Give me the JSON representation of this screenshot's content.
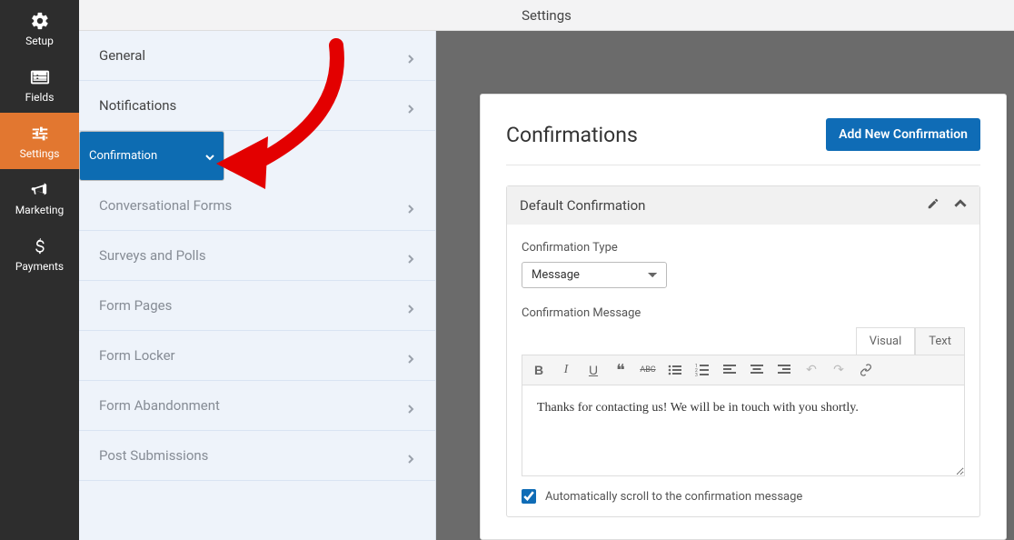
{
  "top": {
    "title": "Settings"
  },
  "nav": {
    "items": [
      {
        "label": "Setup",
        "icon": "gear"
      },
      {
        "label": "Fields",
        "icon": "list"
      },
      {
        "label": "Settings",
        "icon": "sliders",
        "active": true
      },
      {
        "label": "Marketing",
        "icon": "bullhorn"
      },
      {
        "label": "Payments",
        "icon": "dollar"
      }
    ]
  },
  "settings_menu": {
    "items": [
      {
        "label": "General",
        "style": "dark"
      },
      {
        "label": "Notifications",
        "style": "dark"
      },
      {
        "label": "Confirmation",
        "style": "selected"
      },
      {
        "label": "Conversational Forms",
        "style": "dim"
      },
      {
        "label": "Surveys and Polls",
        "style": "dim"
      },
      {
        "label": "Form Pages",
        "style": "dim"
      },
      {
        "label": "Form Locker",
        "style": "dim"
      },
      {
        "label": "Form Abandonment",
        "style": "dim"
      },
      {
        "label": "Post Submissions",
        "style": "dim"
      }
    ]
  },
  "panel": {
    "heading": "Confirmations",
    "add_button": "Add New Confirmation",
    "card_title": "Default Confirmation",
    "type_label": "Confirmation Type",
    "type_value": "Message",
    "message_label": "Confirmation Message",
    "editor_tabs": {
      "visual": "Visual",
      "text": "Text"
    },
    "message_body": "Thanks for contacting us! We will be in touch with you shortly.",
    "scroll_checkbox": "Automatically scroll to the confirmation message",
    "scroll_checked": true
  },
  "colors": {
    "accent": "#0f6cb6",
    "orange": "#e27730"
  }
}
